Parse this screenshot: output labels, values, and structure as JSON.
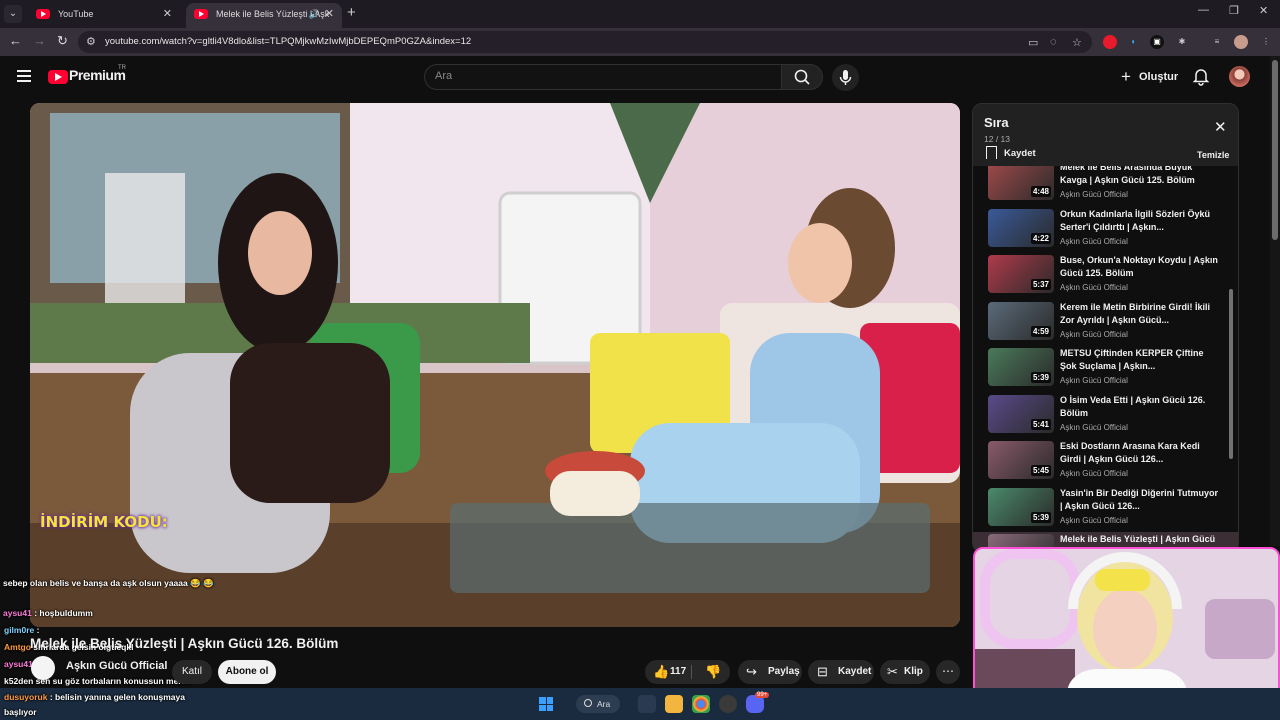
{
  "browser": {
    "tabs": [
      {
        "label": "YouTube",
        "active": false
      },
      {
        "label": "Melek ile Belis Yüzleşti | Aşk",
        "active": true
      }
    ],
    "url": "youtube.com/watch?v=gltli4V8dlo&list=TLPQMjkwMzIwMjbDEPEQmP0GZA&index=12"
  },
  "header": {
    "brand": "Premium",
    "brand_sup": "TR",
    "search_placeholder": "Ara",
    "create_label": "Oluştur"
  },
  "video": {
    "title": "Melek ile Belis Yüzleşti | Aşkın Gücü 126. Bölüm",
    "channel": "Aşkın Gücü Official",
    "join_label": "Katıl",
    "subscribe_label": "Abone ol",
    "like_count": "117",
    "share_label": "Paylaş",
    "save_label": "Kaydet",
    "clip_label": "Klip",
    "overlay_text": "İNDİRİM KODU:"
  },
  "chat": [
    {
      "nick": "",
      "text": "sebep olan belis ve banşa da aşk olsun yaaaa 😂 😂",
      "color": "#ffffff"
    },
    {
      "nick": "aysu41",
      "text": ": hoşbuldumm",
      "color": "#ff7ad9"
    },
    {
      "nick": "gilm0re",
      "text": ":",
      "color": "#7fd0ff"
    },
    {
      "nick": "Amtgo",
      "text": "sıfırlarda gelsin olgtieqkl",
      "color": "#ff9a3c"
    },
    {
      "nick": "aysu41",
      "text": "",
      "color": "#ff7ad9"
    },
    {
      "nick": "k52den",
      "text": "sen su göz torbaların konussun melek",
      "color": "#ffffff"
    },
    {
      "nick": "dusuyoruk",
      "text": ": belisin yanına gelen konuşmaya",
      "color": "#ff9a3c"
    },
    {
      "nick": "",
      "text": "başlıyor",
      "color": "#ffffff"
    }
  ],
  "playlist": {
    "title": "Sıra",
    "position": "12 / 13",
    "save_label": "Kaydet",
    "clear_label": "Temizle",
    "items": [
      {
        "title": "Melek ile Belis Arasında Büyük Kavga | Aşkın Gücü 125. Bölüm",
        "channel": "Aşkın Gücü Official",
        "duration": "4:48",
        "thumb": "#a04a4a"
      },
      {
        "title": "Orkun Kadınlarla İlgili Sözleri Öykü Serter'i Çıldırttı | Aşkın...",
        "channel": "Aşkın Gücü Official",
        "duration": "4:22",
        "thumb": "#3a5a9a"
      },
      {
        "title": "Buse, Orkun'a Noktayı Koydu | Aşkın Gücü 125. Bölüm",
        "channel": "Aşkın Gücü Official",
        "duration": "5:37",
        "thumb": "#b03a4a"
      },
      {
        "title": "Kerem ile Metin Birbirine Girdi! İkili Zor Ayrıldı | Aşkın Gücü...",
        "channel": "Aşkın Gücü Official",
        "duration": "4:59",
        "thumb": "#5a6a7a"
      },
      {
        "title": "METSU Çiftinden KERPER Çiftine Şok Suçlama | Aşkın...",
        "channel": "Aşkın Gücü Official",
        "duration": "5:39",
        "thumb": "#4a7a5a"
      },
      {
        "title": "O İsim Veda Etti | Aşkın Gücü 126. Bölüm",
        "channel": "Aşkın Gücü Official",
        "duration": "5:41",
        "thumb": "#5a4a8a"
      },
      {
        "title": "Eski Dostların Arasına Kara Kedi Girdi | Aşkın Gücü 126...",
        "channel": "Aşkın Gücü Official",
        "duration": "5:45",
        "thumb": "#8a5a6a"
      },
      {
        "title": "Yasin'in Bir Dediği Diğerini Tutmuyor | Aşkın Gücü 126...",
        "channel": "Aşkın Gücü Official",
        "duration": "5:39",
        "thumb": "#4a8a6a"
      },
      {
        "title": "Melek ile Belis Yüzleşti | Aşkın Gücü",
        "channel": "",
        "duration": "",
        "thumb": "#8a6a7a",
        "active": true
      }
    ]
  },
  "taskbar": {
    "search_label": "Ara",
    "badge": "99+"
  },
  "colors": {
    "accent_red": "#ff0033",
    "bg": "#0f0f0f",
    "stream_border": "#ff4fd6"
  }
}
